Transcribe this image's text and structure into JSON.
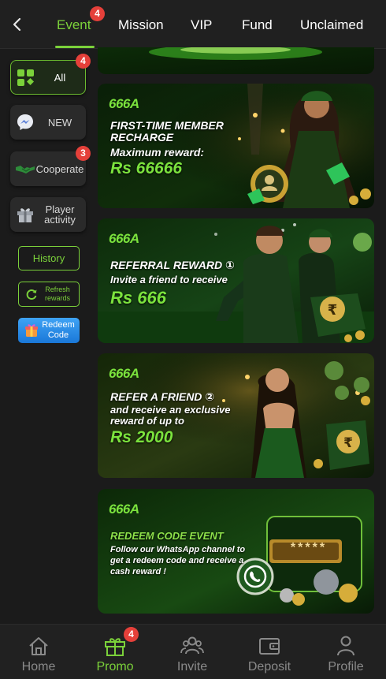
{
  "tabs": [
    {
      "label": "Event",
      "active": true,
      "badge": "4"
    },
    {
      "label": "Mission"
    },
    {
      "label": "VIP"
    },
    {
      "label": "Fund"
    },
    {
      "label": "Unclaimed"
    }
  ],
  "categories": [
    {
      "label": "All",
      "icon": "grid-icon",
      "active": true,
      "badge": "4"
    },
    {
      "label": "NEW",
      "icon": "messenger-icon"
    },
    {
      "label": "Cooperate",
      "icon": "handshake-icon",
      "badge": "3"
    },
    {
      "label": "Player activity",
      "icon": "gift-icon"
    }
  ],
  "side_buttons": {
    "history": "History",
    "refresh": "Refresh rewards",
    "redeem": "Redeem Code"
  },
  "banners": [
    {
      "logo": "666A",
      "title": "FIRST-TIME MEMBER RECHARGE",
      "subtitle": "Maximum reward:",
      "amount": "Rs 66666"
    },
    {
      "logo": "666A",
      "title": "REFERRAL REWARD ①",
      "subtitle": "Invite a friend to receive",
      "amount": "Rs 666"
    },
    {
      "logo": "666A",
      "title": "REFER A FRIEND ②",
      "subtitle": "and receive an exclusive reward of up to",
      "amount": "Rs 2000"
    },
    {
      "logo": "666A",
      "title": "REDEEM CODE EVENT",
      "subtitle": "Follow our WhatsApp channel to get a redeem code and receive a cash reward !",
      "code_mask": "*****"
    }
  ],
  "bottom_nav": [
    {
      "label": "Home",
      "icon": "home-icon"
    },
    {
      "label": "Promo",
      "icon": "gift-icon",
      "active": true,
      "badge": "4"
    },
    {
      "label": "Invite",
      "icon": "people-icon"
    },
    {
      "label": "Deposit",
      "icon": "wallet-icon"
    },
    {
      "label": "Profile",
      "icon": "person-icon"
    }
  ],
  "colors": {
    "accent": "#7bd13a",
    "badge": "#e5403a",
    "background": "#1b1b1b"
  }
}
